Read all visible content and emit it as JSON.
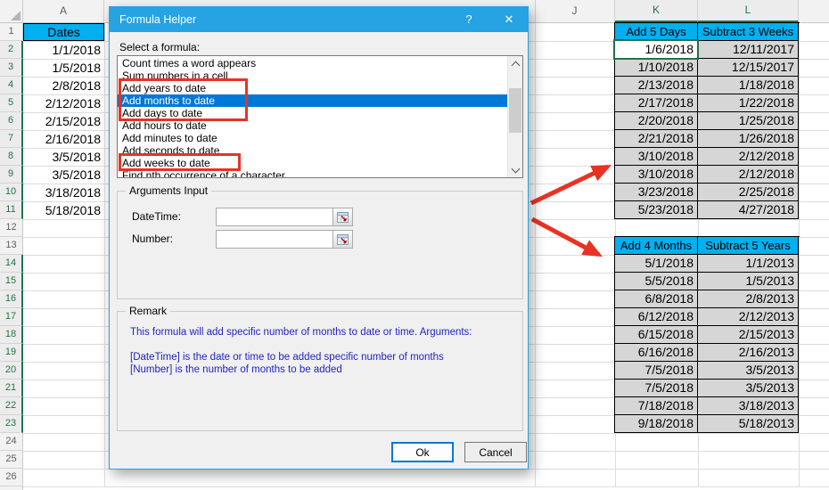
{
  "colors": {
    "titlebar_blue": "#25A3E3",
    "header_cyan": "#00B0F0",
    "selection_gray": "#D6D6D6",
    "excel_green": "#217346",
    "list_selection_blue": "#0078D7",
    "remark_text_blue": "#2222CC",
    "annotation_red": "#E93223"
  },
  "spreadsheet": {
    "column_letters": [
      "A",
      "J",
      "K",
      "L"
    ],
    "selected_columns": [
      "K",
      "L"
    ],
    "row_numbers": [
      1,
      2,
      3,
      4,
      5,
      6,
      7,
      8,
      9,
      10,
      11,
      12,
      13,
      14,
      15,
      16,
      17,
      18,
      19,
      20,
      21,
      22,
      23,
      24,
      25,
      26
    ],
    "selected_rows": [
      2,
      3,
      4,
      5,
      6,
      7,
      8,
      9,
      10,
      11,
      14,
      15,
      16,
      17,
      18,
      19,
      20,
      21,
      22,
      23
    ],
    "dates_column": {
      "header": "Dates",
      "values": [
        "1/1/2018",
        "1/5/2018",
        "2/8/2018",
        "2/12/2018",
        "2/15/2018",
        "2/16/2018",
        "3/5/2018",
        "3/5/2018",
        "3/18/2018",
        "5/18/2018"
      ]
    },
    "table_add_days": {
      "headers": [
        "Add 5 Days",
        "Subtract 3 Weeks"
      ],
      "rows": [
        [
          "1/6/2018",
          "12/11/2017"
        ],
        [
          "1/10/2018",
          "12/15/2017"
        ],
        [
          "2/13/2018",
          "1/18/2018"
        ],
        [
          "2/17/2018",
          "1/22/2018"
        ],
        [
          "2/20/2018",
          "1/25/2018"
        ],
        [
          "2/21/2018",
          "1/26/2018"
        ],
        [
          "3/10/2018",
          "2/12/2018"
        ],
        [
          "3/10/2018",
          "2/12/2018"
        ],
        [
          "3/23/2018",
          "2/25/2018"
        ],
        [
          "5/23/2018",
          "4/27/2018"
        ]
      ]
    },
    "table_add_months": {
      "headers": [
        "Add 4 Months",
        "Subtract 5 Years"
      ],
      "rows": [
        [
          "5/1/2018",
          "1/1/2013"
        ],
        [
          "5/5/2018",
          "1/5/2013"
        ],
        [
          "6/8/2018",
          "2/8/2013"
        ],
        [
          "6/12/2018",
          "2/12/2013"
        ],
        [
          "6/15/2018",
          "2/15/2013"
        ],
        [
          "6/16/2018",
          "2/16/2013"
        ],
        [
          "7/5/2018",
          "3/5/2013"
        ],
        [
          "7/5/2018",
          "3/5/2013"
        ],
        [
          "7/18/2018",
          "3/18/2013"
        ],
        [
          "9/18/2018",
          "5/18/2013"
        ]
      ]
    }
  },
  "dialog": {
    "title": "Formula Helper",
    "help_button": "?",
    "close_button": "✕",
    "select_label": "Select a formula:",
    "formulas": [
      "Count times a word appears",
      "Sum numbers in a cell",
      "Add years to date",
      "Add months to date",
      "Add days to date",
      "Add hours to date",
      "Add minutes to date",
      "Add seconds to date",
      "Add weeks to date",
      "Find nth occurrence of a character"
    ],
    "selected_formula": "Add months to date",
    "arguments_group": {
      "label": "Arguments Input",
      "fields": [
        {
          "label": "DateTime:",
          "value": ""
        },
        {
          "label": "Number:",
          "value": ""
        }
      ]
    },
    "remark_group": {
      "label": "Remark",
      "lines": [
        "This formula will add specific number of months to date or time. Arguments:",
        "",
        "[DateTime] is the date or time to be added specific number of months",
        "[Number] is the number of months to be added"
      ]
    },
    "buttons": {
      "ok": "Ok",
      "cancel": "Cancel"
    }
  }
}
